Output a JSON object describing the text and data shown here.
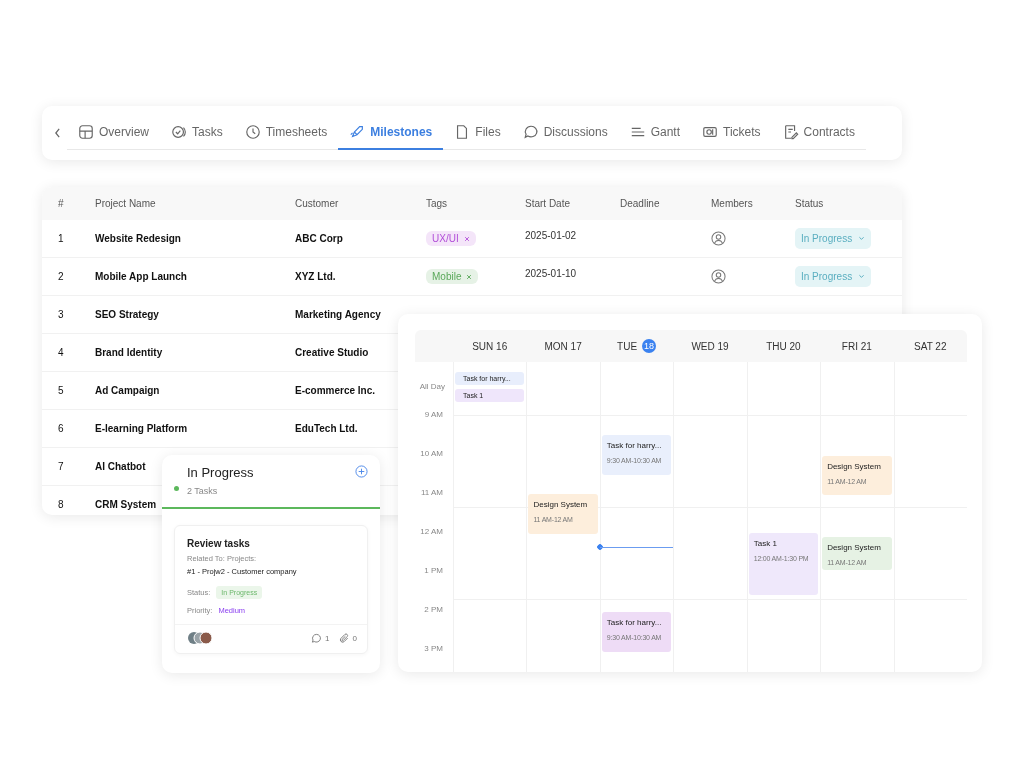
{
  "tabs": [
    {
      "label": "Overview",
      "selected": false
    },
    {
      "label": "Tasks",
      "selected": false
    },
    {
      "label": "Timesheets",
      "selected": false
    },
    {
      "label": "Milestones",
      "selected": true
    },
    {
      "label": "Files",
      "selected": false
    },
    {
      "label": "Discussions",
      "selected": false
    },
    {
      "label": "Gantt",
      "selected": false
    },
    {
      "label": "Tickets",
      "selected": false
    },
    {
      "label": "Contracts",
      "selected": false
    }
  ],
  "table": {
    "columns": [
      "#",
      "Project Name",
      "Customer",
      "Tags",
      "Start Date",
      "Deadline",
      "Members",
      "Status"
    ],
    "rows": [
      {
        "num": "1",
        "name": "Website Redesign",
        "customer": "ABC Corp",
        "tag": {
          "label": "UX/UI",
          "color": "#b24fd8"
        },
        "start_date": "2025-01-02",
        "status": "In Progress"
      },
      {
        "num": "2",
        "name": "Mobile App Launch",
        "customer": "XYZ Ltd.",
        "tag": {
          "label": "Mobile",
          "color": "#5aa85a"
        },
        "start_date": "2025-01-10",
        "status": "In Progress"
      },
      {
        "num": "3",
        "name": "SEO Strategy",
        "customer": "Marketing Agency"
      },
      {
        "num": "4",
        "name": "Brand Identity",
        "customer": "Creative Studio"
      },
      {
        "num": "5",
        "name": "Ad Campaign",
        "customer": "E-commerce Inc."
      },
      {
        "num": "6",
        "name": "E-learning Platform",
        "customer": "EduTech Ltd."
      },
      {
        "num": "7",
        "name": "AI Chatbot"
      },
      {
        "num": "8",
        "name": "CRM System"
      }
    ]
  },
  "calendar": {
    "days": [
      {
        "label": "SUN 16"
      },
      {
        "label": "MON 17"
      },
      {
        "label": "TUE",
        "date": "18"
      },
      {
        "label": "WED 19"
      },
      {
        "label": "THU 20"
      },
      {
        "label": "FRI 21"
      },
      {
        "label": "SAT 22"
      }
    ],
    "all_day_label": "All Day",
    "all_day_events": [
      {
        "title": "Task for harry...",
        "color": "#e8eefc"
      },
      {
        "title": "Task 1",
        "color": "#efe6fb"
      }
    ],
    "hours": [
      "9 AM",
      "10 AM",
      "11 AM",
      "12 AM",
      "1 PM",
      "2 PM",
      "3 PM"
    ],
    "events": [
      {
        "title": "Task for harry...",
        "time": "9:30 AM-10:30 AM",
        "color": "#e9effc"
      },
      {
        "title": "Design System",
        "time": "11 AM-12 AM",
        "color": "#fdeedc"
      },
      {
        "title": "Design System",
        "time": "11 AM-12 AM",
        "color": "#fdeedc"
      },
      {
        "title": "Task 1",
        "time": "12:00 AM-1:30 PM",
        "color": "#efe8fb"
      },
      {
        "title": "Design System",
        "time": "11 AM-12 AM",
        "color": "#e6f2e4"
      },
      {
        "title": "Task for harry...",
        "time": "9:30 AM-10:30 AM",
        "color": "#eedcf6"
      }
    ]
  },
  "kanban": {
    "column_title": "In Progress",
    "count": "2 Tasks",
    "color": "#5cb85c",
    "task": {
      "title": "Review tasks",
      "related_label": "Related To: Projects:",
      "related": "#1 - Projw2 - Customer company",
      "status_label": "Status:",
      "status": "In Progress",
      "priority_label": "Priority:",
      "priority": "Medium",
      "comments": "1",
      "attachments": "0"
    }
  }
}
